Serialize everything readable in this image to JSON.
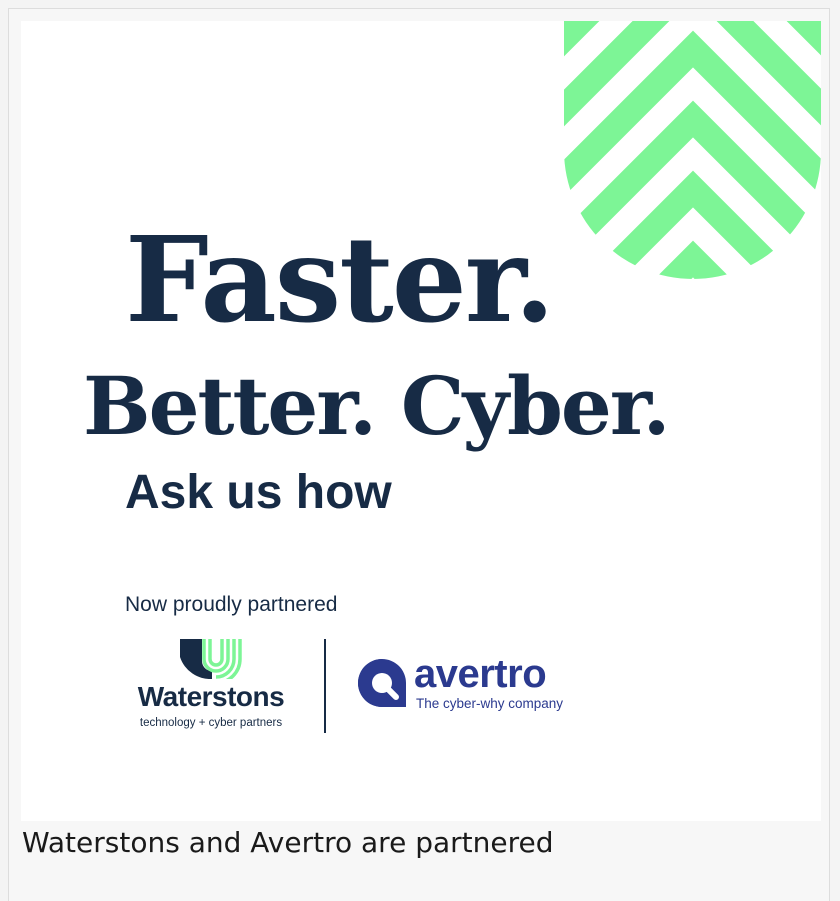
{
  "headline": {
    "line1": "Faster.",
    "line2": "Better. Cyber.",
    "line3": "Ask us how"
  },
  "partner_line": "Now proudly partnered",
  "waterstons": {
    "name": "Waterstons",
    "tagline": "technology + cyber partners"
  },
  "avertro": {
    "name": "avertro",
    "tagline": "The cyber-why company"
  },
  "caption": "Waterstons and Avertro are partnered",
  "colors": {
    "navy": "#172b45",
    "green": "#7df596",
    "avertro_blue": "#2b3a8f",
    "background": "#ffffff"
  }
}
